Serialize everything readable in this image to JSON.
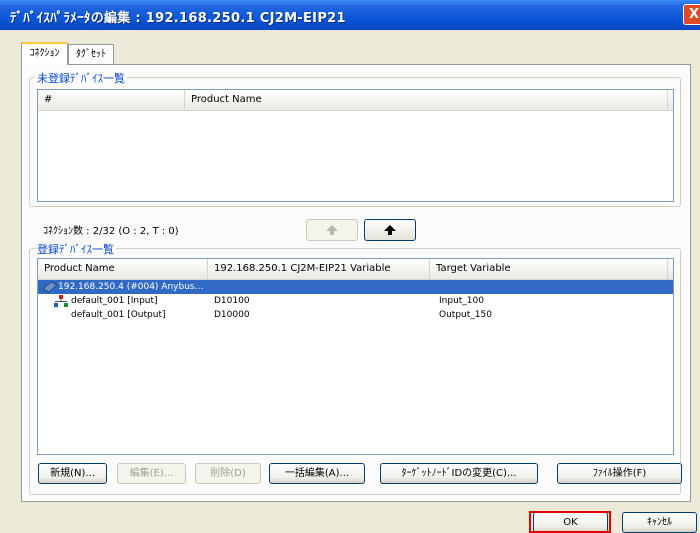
{
  "window": {
    "title": "ﾃﾞﾊﾞｲｽﾊﾟﾗﾒｰﾀの編集 : 192.168.250.1 CJ2M-EIP21",
    "close_label": "X"
  },
  "tabs": [
    {
      "label": "ｺﾈｸｼｮﾝ",
      "active": true
    },
    {
      "label": "ﾀｸﾞｾｯﾄ",
      "active": false
    }
  ],
  "unregistered": {
    "group_label": "未登録ﾃﾞﾊﾞｲｽ一覧",
    "columns": [
      "#",
      "Product Name"
    ]
  },
  "connection_count": "ｺﾈｸｼｮﾝ数 : 2/32 (O : 2, T : 0)",
  "registered": {
    "group_label": "登録ﾃﾞﾊﾞｲｽ一覧",
    "columns": [
      "Product Name",
      "192.168.250.1 CJ2M-EIP21 Variable",
      "Target Variable"
    ],
    "rows": [
      {
        "name": "192.168.250.4 (#004) Anybus...",
        "variable": "",
        "target": "",
        "selected": true,
        "icon": "device-icon"
      },
      {
        "name": "default_001 [Input]",
        "variable": "D10100",
        "target": "Input_100",
        "selected": false,
        "icon": "connection-icon"
      },
      {
        "name": "default_001 [Output]",
        "variable": "D10000",
        "target": "Output_150",
        "selected": false,
        "icon": ""
      }
    ]
  },
  "buttons": {
    "new": "新規(N)...",
    "edit": "編集(E)...",
    "delete": "削除(D)",
    "batch_edit": "一括編集(A)...",
    "change_target": "ﾀｰｹﾞｯﾄﾉｰﾄﾞIDの変更(C)...",
    "file_ops": "ﾌｧｲﾙ操作(F)",
    "ok": "OK",
    "cancel": "ｷｬﾝｾﾙ"
  },
  "icons": {
    "move_up": "move-up-icon",
    "move_down": "move-down-icon"
  },
  "colors": {
    "titlebar": "#0a58d8",
    "selection": "#316ac5",
    "group_label": "#0046d5",
    "highlight": "#e00000"
  }
}
